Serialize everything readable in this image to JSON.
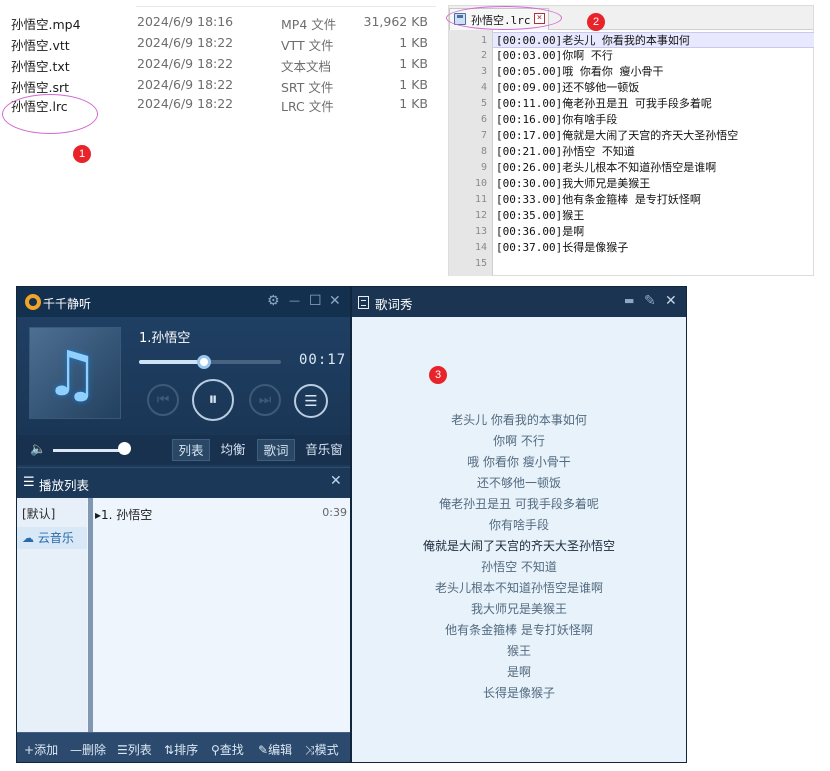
{
  "explorer": {
    "files": [
      {
        "name": "孙悟空.mp4",
        "date": "2024/6/9 18:16",
        "type": "MP4 文件",
        "size": "31,962 KB"
      },
      {
        "name": "孙悟空.vtt",
        "date": "2024/6/9 18:22",
        "type": "VTT 文件",
        "size": "1 KB"
      },
      {
        "name": "孙悟空.txt",
        "date": "2024/6/9 18:22",
        "type": "文本文档",
        "size": "1 KB"
      },
      {
        "name": "孙悟空.srt",
        "date": "2024/6/9 18:22",
        "type": "SRT 文件",
        "size": "1 KB"
      },
      {
        "name": "孙悟空.lrc",
        "date": "2024/6/9 18:22",
        "type": "LRC 文件",
        "size": "1 KB"
      }
    ]
  },
  "badges": {
    "one": "1",
    "two": "2",
    "three": "3"
  },
  "editor": {
    "tab_title": "孙悟空.lrc",
    "close_glyph": "×",
    "active_line": 1,
    "lines": [
      {
        "no": "1",
        "text": "[00:00.00]老头儿 你看我的本事如何"
      },
      {
        "no": "2",
        "text": "[00:03.00]你啊 不行"
      },
      {
        "no": "3",
        "text": "[00:05.00]哦 你看你 瘦小骨干"
      },
      {
        "no": "4",
        "text": "[00:09.00]还不够他一顿饭"
      },
      {
        "no": "5",
        "text": "[00:11.00]俺老孙丑是丑 可我手段多着呢"
      },
      {
        "no": "6",
        "text": "[00:16.00]你有啥手段"
      },
      {
        "no": "7",
        "text": "[00:17.00]俺就是大闹了天宫的齐天大圣孙悟空"
      },
      {
        "no": "8",
        "text": "[00:21.00]孙悟空 不知道"
      },
      {
        "no": "9",
        "text": "[00:26.00]老头儿根本不知道孙悟空是谁啊"
      },
      {
        "no": "10",
        "text": "[00:30.00]我大师兄是美猴王"
      },
      {
        "no": "11",
        "text": "[00:33.00]他有条金箍棒 是专打妖怪啊"
      },
      {
        "no": "12",
        "text": "[00:35.00]猴王"
      },
      {
        "no": "13",
        "text": "[00:36.00]是啊"
      },
      {
        "no": "14",
        "text": "[00:37.00]长得是像猴子"
      },
      {
        "no": "15",
        "text": ""
      }
    ]
  },
  "player": {
    "app_title": "千千静听",
    "song_title": "1.孙悟空",
    "time": "00:17",
    "progress": 0.46,
    "volume": 1.0,
    "icons": {
      "settings": "⚙",
      "minimize": "—",
      "maximize": "☐",
      "close": "✕",
      "prev": "⏮",
      "pause": "⏸",
      "next": "⏭",
      "mode": "☰",
      "volume": "🔈",
      "menu": "☰"
    },
    "tabs": [
      "列表",
      "均衡",
      "歌词",
      "音乐窗"
    ],
    "selected_tabs": [
      "列表",
      "歌词"
    ],
    "playlist": {
      "title": "播放列表",
      "close": "✕",
      "groups": [
        "[默认]",
        "云音乐"
      ],
      "cloud_icon": "☁",
      "track": {
        "name": "▸1. 孙悟空",
        "duration": "0:39"
      }
    },
    "footer": [
      {
        "icon": "+",
        "label": "添加"
      },
      {
        "icon": "—",
        "label": "删除"
      },
      {
        "icon": "☰",
        "label": "列表"
      },
      {
        "icon": "⇅",
        "label": "排序"
      },
      {
        "icon": "⚲",
        "label": "查找"
      },
      {
        "icon": "✎",
        "label": "编辑"
      },
      {
        "icon": "⤨",
        "label": "模式"
      }
    ]
  },
  "lyrics": {
    "title": "歌词秀",
    "icons": {
      "minimize": "▬",
      "pin": "✎",
      "close": "✕"
    },
    "current_index": 6,
    "lines": [
      "老头儿 你看我的本事如何",
      "你啊 不行",
      "哦 你看你 瘦小骨干",
      "还不够他一顿饭",
      "俺老孙丑是丑 可我手段多着呢",
      "你有啥手段",
      "俺就是大闹了天宫的齐天大圣孙悟空",
      "孙悟空 不知道",
      "老头儿根本不知道孙悟空是谁啊",
      "我大师兄是美猴王",
      "他有条金箍棒 是专打妖怪啊",
      "猴王",
      "是啊",
      "长得是像猴子"
    ]
  }
}
